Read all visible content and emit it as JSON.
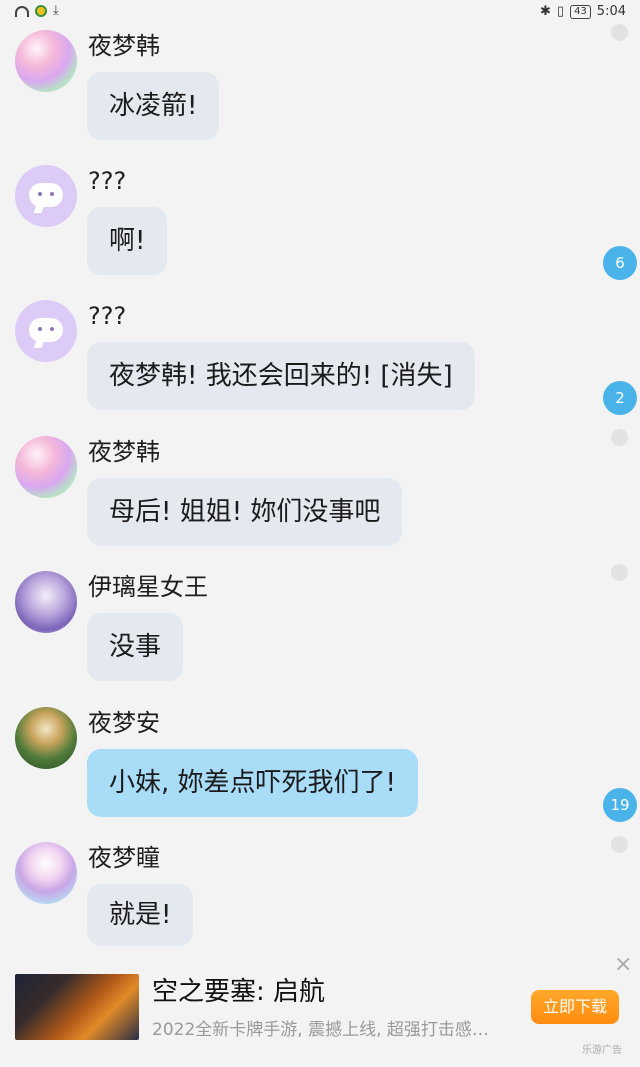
{
  "status_bar": {
    "battery": "43",
    "time": "5:04"
  },
  "messages": [
    {
      "name": "夜梦韩",
      "text": "冰凌箭!",
      "avatar": "anime-girl-pink-avatar",
      "bubble_color": "#e4e8ef"
    },
    {
      "name": "???",
      "text": "啊!",
      "avatar": "ghost-chat-avatar",
      "bubble_color": "#e4e8ef"
    },
    {
      "name": "???",
      "text": "夜梦韩! 我还会回来的! [消失]",
      "avatar": "ghost-chat-avatar",
      "bubble_color": "#e4e8ef"
    },
    {
      "name": "夜梦韩",
      "text": "母后! 姐姐! 妳们没事吧",
      "avatar": "anime-girl-pink-avatar",
      "bubble_color": "#e4e8ef"
    },
    {
      "name": "伊璃星女王",
      "text": "没事",
      "avatar": "anime-queen-purple-avatar",
      "bubble_color": "#e4e8ef"
    },
    {
      "name": "夜梦安",
      "text": "小妹, 妳差点吓死我们了!",
      "avatar": "anime-girl-green-avatar",
      "bubble_color": "#a9dcf7"
    },
    {
      "name": "夜梦瞳",
      "text": "就是!",
      "avatar": "anime-girl-lilac-avatar",
      "bubble_color": "#e4e8ef"
    }
  ],
  "badges": [
    "6",
    "2",
    "19"
  ],
  "ad": {
    "title": "空之要塞: 启航",
    "description": "2022全新卡牌手游, 震撼上线, 超强打击感…",
    "button_label": "立即下载",
    "close_label": "×",
    "source": "乐游广告"
  },
  "colors": {
    "badge": "#4ab4ea",
    "ad_button": "#ff9a1c",
    "bubble": "#e4e8ef",
    "bubble_highlight": "#a9dcf7"
  }
}
